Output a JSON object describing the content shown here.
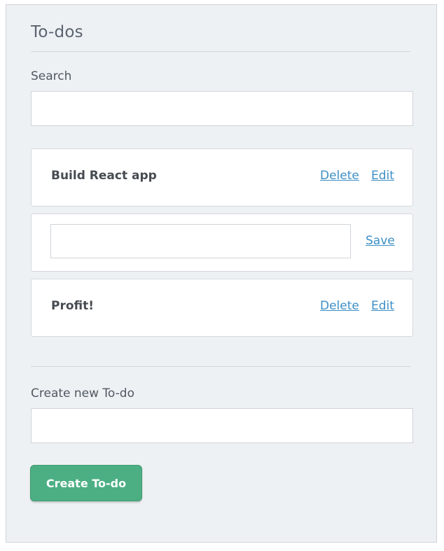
{
  "header": {
    "title": "To-dos"
  },
  "search": {
    "label": "Search",
    "value": "",
    "placeholder": ""
  },
  "todos": [
    {
      "text": "Build React app",
      "mode": "view",
      "delete_label": "Delete",
      "edit_label": "Edit"
    },
    {
      "text": "",
      "mode": "edit",
      "save_label": "Save"
    },
    {
      "text": "Profit!",
      "mode": "view",
      "delete_label": "Delete",
      "edit_label": "Edit"
    }
  ],
  "create": {
    "label": "Create new To-do",
    "value": "",
    "placeholder": "",
    "button_label": "Create To-do"
  },
  "colors": {
    "panel_bg": "#eef1f4",
    "link": "#3d8fc6",
    "primary_button": "#4caf84"
  }
}
